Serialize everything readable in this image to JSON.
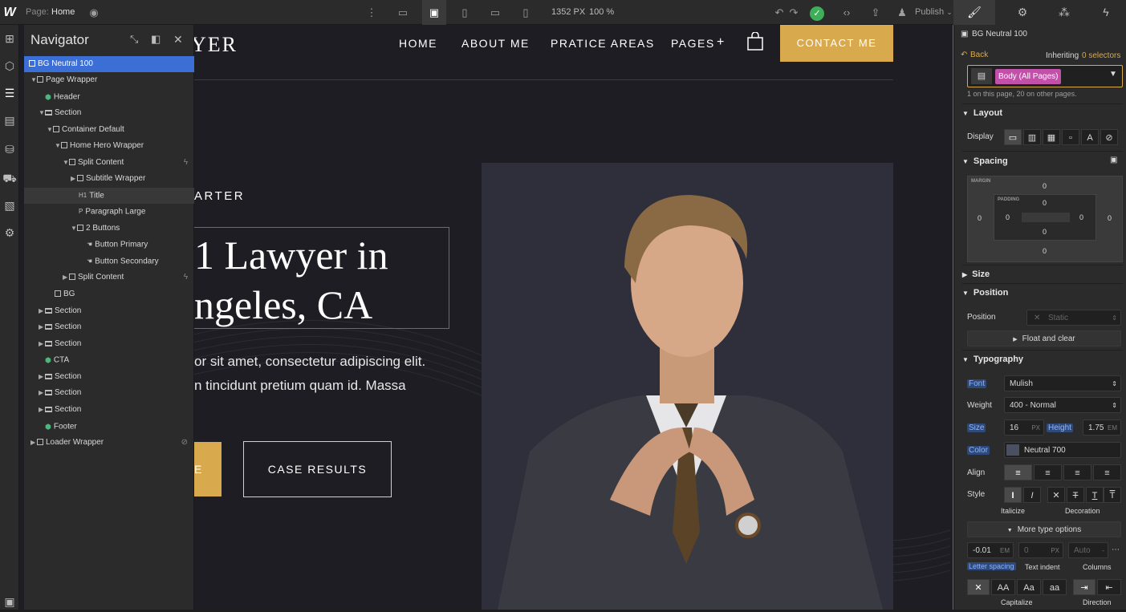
{
  "topbar": {
    "logo": "W",
    "page_label": "Page:",
    "page_name": "Home",
    "width_value": "1352 PX",
    "zoom": "100 %",
    "publish_label": "Publish"
  },
  "navigator": {
    "title": "Navigator",
    "items": [
      {
        "label": "BG Neutral 100"
      },
      {
        "label": "Page Wrapper"
      },
      {
        "label": "Header"
      },
      {
        "label": "Section"
      },
      {
        "label": "Container Default"
      },
      {
        "label": "Home Hero Wrapper"
      },
      {
        "label": "Split Content"
      },
      {
        "label": "Subtitle Wrapper"
      },
      {
        "label": "Title"
      },
      {
        "label": "Paragraph Large"
      },
      {
        "label": "2 Buttons"
      },
      {
        "label": "Button Primary"
      },
      {
        "label": "Button Secondary"
      },
      {
        "label": "Split Content"
      },
      {
        "label": "BG"
      },
      {
        "label": "Section"
      },
      {
        "label": "Section"
      },
      {
        "label": "Section"
      },
      {
        "label": "CTA"
      },
      {
        "label": "Section"
      },
      {
        "label": "Section"
      },
      {
        "label": "Section"
      },
      {
        "label": "Footer"
      },
      {
        "label": "Loader Wrapper"
      }
    ],
    "title_prefix": "H1",
    "para_prefix": "P"
  },
  "site": {
    "logo_fragment": "YER",
    "nav": {
      "home": "HOME",
      "about": "ABOUT ME",
      "practice": "PRATICE AREAS",
      "pages": "PAGES",
      "pages_plus": "+",
      "contact": "CONTACT ME"
    },
    "subtitle": "ARTER",
    "title_line1": "1 Lawyer in",
    "title_line2": "ngeles, CA",
    "para_line1": "or sit amet, consectetur adipiscing elit.",
    "para_line2": "n tincidunt pretium quam id. Massa",
    "btn_primary_fragment": "E",
    "btn_secondary": "CASE RESULTS"
  },
  "panel": {
    "selected_element": "BG Neutral 100",
    "back": "Back",
    "inheriting": "Inheriting",
    "inheriting_count": "0 selectors",
    "selector_tag": "Body (All Pages)",
    "selector_note": "1 on this page, 20 on other pages.",
    "layout": "Layout",
    "display_label": "Display",
    "spacing": "Spacing",
    "margin_label": "MARGIN",
    "padding_label": "PADDING",
    "margin": {
      "top": "0",
      "right": "0",
      "bottom": "0",
      "left": "0"
    },
    "padding": {
      "top": "0",
      "right": "0",
      "bottom": "0",
      "left": "0"
    },
    "size": "Size",
    "position": "Position",
    "position_label": "Position",
    "position_value": "Static",
    "float_clear": "Float and clear",
    "typography": "Typography",
    "font_label": "Font",
    "font_value": "Mulish",
    "weight_label": "Weight",
    "weight_value": "400 - Normal",
    "size_label": "Size",
    "size_value": "16",
    "size_unit": "PX",
    "height_label": "Height",
    "height_value": "1.75",
    "height_unit": "EM",
    "color_label": "Color",
    "color_value": "Neutral 700",
    "align_label": "Align",
    "style_label": "Style",
    "italicize": "Italicize",
    "decoration": "Decoration",
    "more_type": "More type options",
    "letter_spacing_value": "-0.01",
    "letter_spacing_unit": "EM",
    "text_indent_value": "0",
    "text_indent_unit": "PX",
    "columns_value": "Auto",
    "letter_spacing_label": "Letter spacing",
    "text_indent_label": "Text indent",
    "columns_label": "Columns",
    "capitalize_label": "Capitalize",
    "direction_label": "Direction",
    "cap_opts": [
      "✕",
      "AA",
      "Aa",
      "aa"
    ]
  },
  "colors": {
    "accent": "#d9a94e",
    "selection": "#3b6fd6",
    "canvas_bg": "#1d1d23",
    "panel_bg": "#2b2b2b",
    "swatch_neutral700": "#4a5060"
  },
  "icons": [
    "eye-icon",
    "desktop-icon",
    "tablet-icon",
    "phone-icon",
    "undo-icon",
    "redo-icon",
    "check-icon",
    "code-icon",
    "export-icon",
    "brush-icon",
    "gear-icon",
    "drops-icon",
    "bolt-icon",
    "plus-icon",
    "cube-icon",
    "layers-icon",
    "page-icon",
    "database-icon",
    "cart-icon",
    "assets-icon",
    "settings-icon",
    "collapse-icon",
    "dock-icon",
    "close-icon",
    "bag-icon"
  ]
}
